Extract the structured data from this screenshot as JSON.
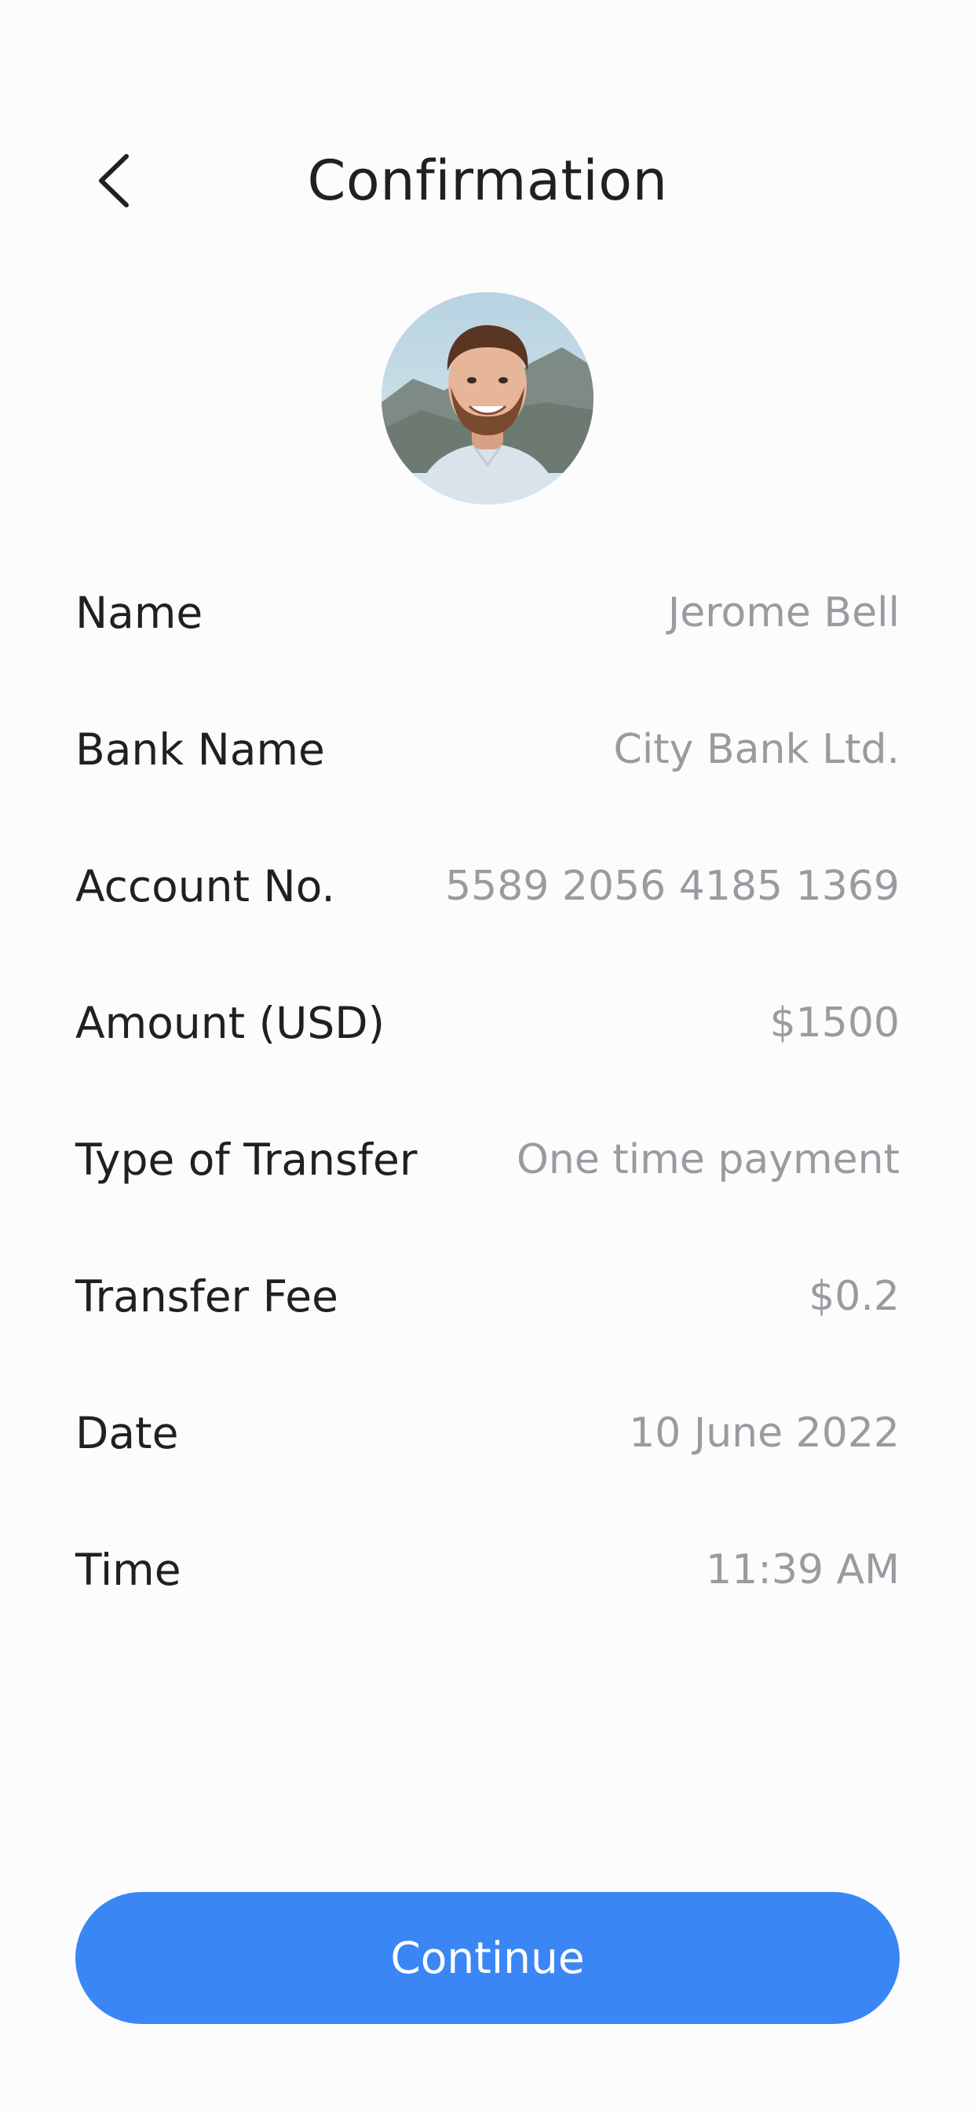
{
  "header": {
    "title": "Confirmation",
    "back_icon": "chevron-left-icon"
  },
  "recipient": {
    "avatar": "profile-photo"
  },
  "details": [
    {
      "label": "Name",
      "value": "Jerome Bell"
    },
    {
      "label": "Bank Name",
      "value": "City Bank Ltd."
    },
    {
      "label": "Account No.",
      "value": "5589 2056 4185 1369"
    },
    {
      "label": "Amount (USD)",
      "value": "$1500"
    },
    {
      "label": "Type of Transfer",
      "value": "One time payment"
    },
    {
      "label": "Transfer Fee",
      "value": "$0.2"
    },
    {
      "label": "Date",
      "value": "10 June 2022"
    },
    {
      "label": "Time",
      "value": "11:39 AM"
    }
  ],
  "footer": {
    "continue_label": "Continue"
  },
  "colors": {
    "accent": "#3a86f5",
    "text_primary": "#1f2024",
    "text_secondary": "#9a9ba0",
    "background": "#fcfcfd"
  }
}
